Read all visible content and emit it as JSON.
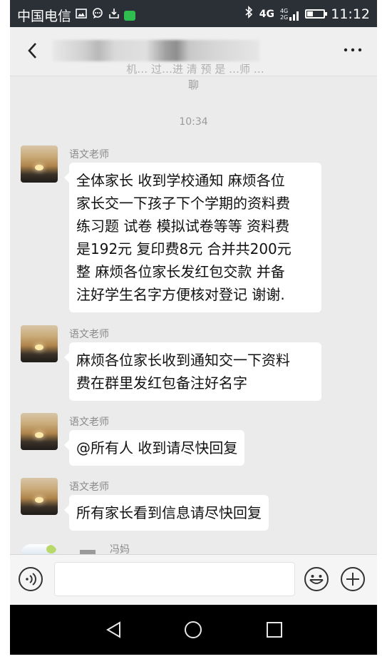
{
  "status_bar": {
    "carrier": "中国电信",
    "network": "4G",
    "network_small_top": "4G",
    "network_small_bottom": "2G",
    "time": "11:12",
    "battery_level": 0.35,
    "icons": [
      "image-icon",
      "chat-bubble-icon",
      "download-icon",
      "app-icon",
      "bluetooth-icon",
      "signal-icon",
      "battery-icon"
    ]
  },
  "header": {
    "title": "",
    "back_icon": "chevron-left-icon",
    "more_icon": "more-horizontal-icon",
    "more_label": "···"
  },
  "chat": {
    "system_text_line1": "机… 过…进 清 预 是 …师 …",
    "system_text_line2": "聊",
    "timestamp": "10:34",
    "messages": [
      {
        "sender": "语文老师",
        "lines": [
          "全体家长 收到学校通知 麻烦各位",
          "家长交一下孩子下个学期的资料费",
          "练习题 试卷 模拟试卷等等 资料费",
          "是192元 复印费8元 合并共200元",
          "整 麻烦各位家长发红包交款 并备",
          "注好学生名字方便核对登记 谢谢."
        ]
      },
      {
        "sender": "语文老师",
        "lines": [
          "麻烦各位家长收到通知交一下资料",
          "费在群里发红包备注好名字"
        ]
      },
      {
        "sender": "语文老师",
        "lines": [
          "@所有人 收到请尽快回复"
        ]
      },
      {
        "sender": "语文老师",
        "lines": [
          "所有家长看到信息请尽快回复"
        ]
      }
    ],
    "partial_sender": "冯妈"
  },
  "input_bar": {
    "value": "",
    "placeholder": "",
    "voice_icon": "voice-icon",
    "emoji_icon": "emoji-icon",
    "plus_icon": "plus-icon"
  },
  "nav_bar": {
    "back_icon": "triangle-back-icon",
    "home_icon": "circle-home-icon",
    "recents_icon": "square-recents-icon"
  },
  "colors": {
    "status_bar_bg": "#2b2f36",
    "chat_bg": "#ebebeb",
    "bubble_bg": "#ffffff",
    "sender_text": "#8a8a8a",
    "nav_bg": "#000000"
  }
}
